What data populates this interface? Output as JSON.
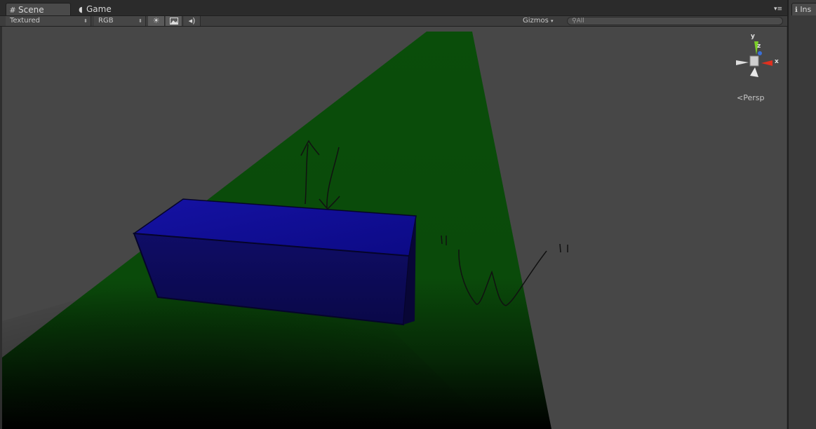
{
  "tabs": [
    {
      "label": "Scene",
      "icon": "grid-icon",
      "active": true
    },
    {
      "label": "Game",
      "icon": "pacman-icon",
      "active": false
    }
  ],
  "toolbar": {
    "render_mode": "Textured",
    "channel": "RGB",
    "lighting_icon": "sun-icon",
    "skybox_icon": "image-icon",
    "audio_icon": "speaker-icon",
    "gizmos_label": "Gizmos",
    "search_placeholder": "All"
  },
  "scene_gizmo": {
    "axis_y": "y",
    "axis_z": "z",
    "axis_x": "x",
    "projection_label": "Persp"
  },
  "inspector": {
    "tab_label": "Ins"
  },
  "colors": {
    "cube_top": "#0f0d90",
    "cube_front": "#0d0b5c",
    "plane": "#0b4a0b",
    "viewport_bg": "#474747"
  }
}
